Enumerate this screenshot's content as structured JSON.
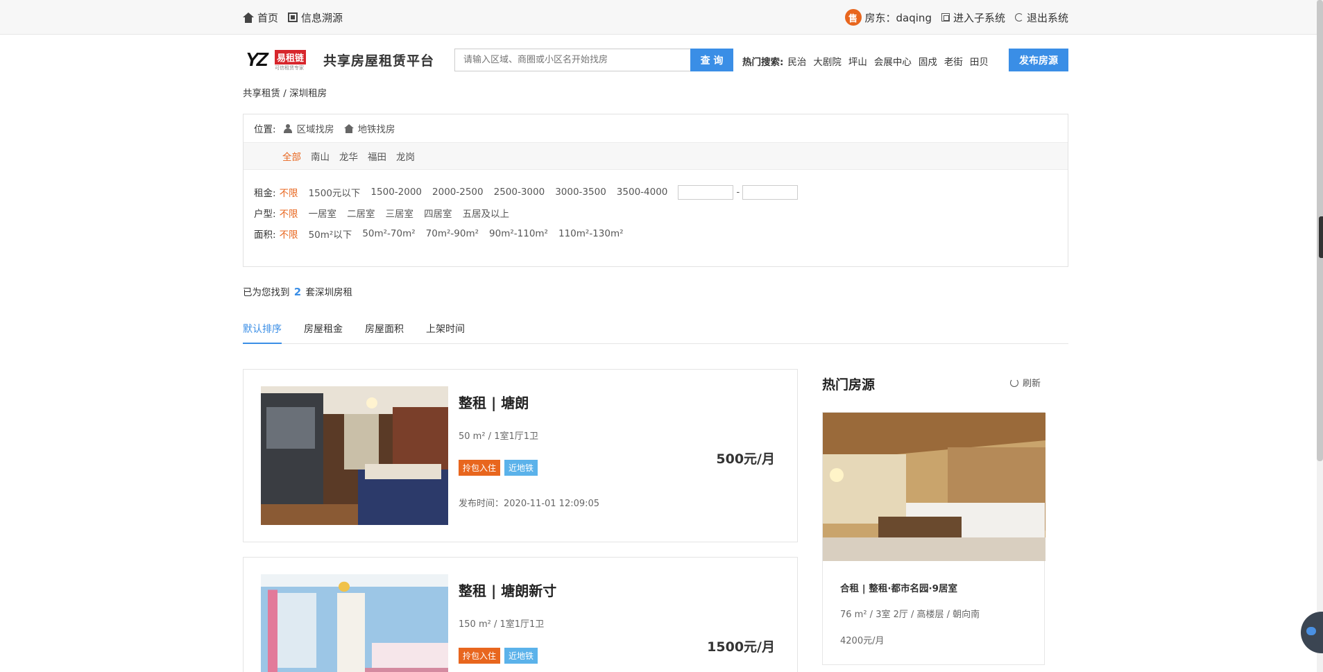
{
  "topbar": {
    "home": "首页",
    "trace": "信息溯源",
    "sell_badge": "售",
    "landlord": "房东：daqing",
    "subsystem": "进入子系统",
    "logout": "退出系统"
  },
  "header": {
    "logo_yz": "YZ",
    "logo_brand": "易租链",
    "logo_tagline": "可信租赁专家",
    "site_title": "共享房屋租赁平台",
    "search_placeholder": "请输入区域、商圈或小区名开始找房",
    "search_button": "查 询",
    "hot_label": "热门搜索:",
    "hot_terms": [
      "民治",
      "大剧院",
      "坪山",
      "会展中心",
      "固戍",
      "老街",
      "田贝"
    ],
    "publish_button": "发布房源"
  },
  "breadcrumb": "共享租赁 / 深圳租房",
  "filter": {
    "location_label": "位置:",
    "location_options": [
      "区域找房",
      "地铁找房"
    ],
    "areas": [
      "全部",
      "南山",
      "龙华",
      "福田",
      "龙岗"
    ],
    "rent_label": "租金:",
    "rent_options": [
      "不限",
      "1500元以下",
      "1500-2000",
      "2000-2500",
      "2500-3000",
      "3000-3500",
      "3500-4000"
    ],
    "rent_dash": "-",
    "layout_label": "户型:",
    "layout_options": [
      "不限",
      "一居室",
      "二居室",
      "三居室",
      "四居室",
      "五居及以上"
    ],
    "area_label": "面积:",
    "area_options": [
      "不限",
      "50m²以下",
      "50m²-70m²",
      "70m²-90m²",
      "90m²-110m²",
      "110m²-130m²"
    ]
  },
  "results": {
    "prefix": "已为您找到",
    "count": "2",
    "suffix": "套深圳房租"
  },
  "sort_tabs": [
    "默认排序",
    "房屋租金",
    "房屋面积",
    "上架时间"
  ],
  "listings": [
    {
      "title": "整租 | 塘朗",
      "meta": "50 m² / 1室1厅1卫",
      "tags": [
        "拎包入住",
        "近地铁"
      ],
      "pubtime": "发布时间：2020-11-01 12:09:05",
      "price": "500元/月"
    },
    {
      "title": "整租 | 塘朗新寸",
      "meta": "150 m² / 1室1厅1卫",
      "tags": [
        "拎包入住",
        "近地铁"
      ],
      "price": "1500元/月"
    }
  ],
  "hot": {
    "title": "热门房源",
    "refresh": "刷新",
    "item": {
      "title": "合租 | 整租·都市名园·9居室",
      "meta": "76 m² / 3室 2厅 / 高楼层 / 朝向南",
      "price": "4200元/月"
    }
  },
  "colors": {
    "accent": "#3a8ee6",
    "active": "#e8661e",
    "tag_orange": "#e8661e",
    "tag_blue": "#5bb2ea"
  }
}
